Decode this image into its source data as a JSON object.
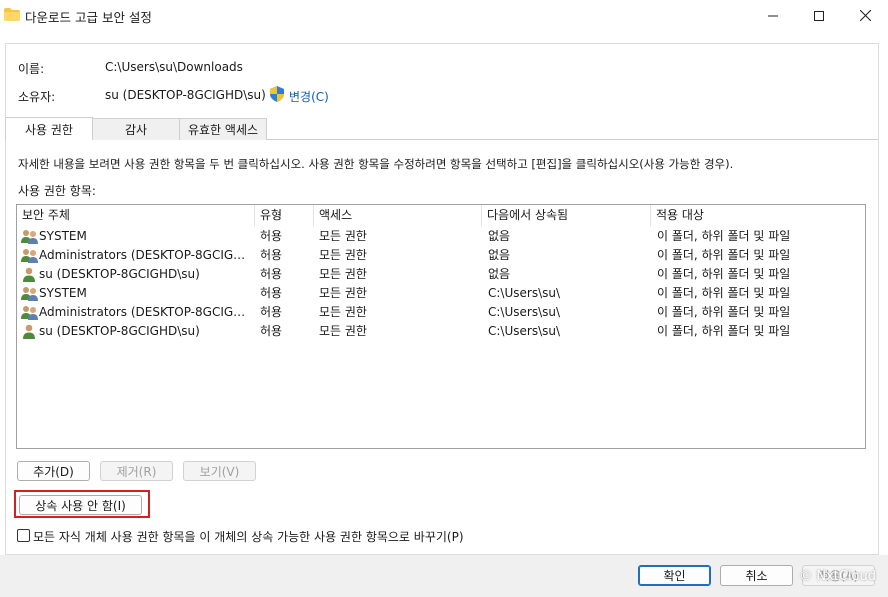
{
  "window": {
    "title": "다운로드 고급 보안 설정",
    "minimize_glyph": "—",
    "maximize_glyph": "☐",
    "close_glyph": "✕"
  },
  "info": {
    "name_label": "이름:",
    "name_value": "C:\\Users\\su\\Downloads",
    "owner_label": "소유자:",
    "owner_value": "su (DESKTOP-8GCIGHD\\su)",
    "change_link": "변경(C)"
  },
  "tabs": [
    {
      "label": "사용 권한",
      "active": true
    },
    {
      "label": "감사",
      "active": false
    },
    {
      "label": "유효한 액세스",
      "active": false
    }
  ],
  "instructions": "자세한 내용을 보려면 사용 권한 항목을 두 번 클릭하십시오. 사용 권한 항목을 수정하려면 항목을 선택하고 [편집]을 클릭하십시오(사용 가능한 경우).",
  "entries_label": "사용 권한 항목:",
  "table": {
    "columns": [
      "보안 주체",
      "유형",
      "액세스",
      "다음에서 상속됨",
      "적용 대상"
    ],
    "rows": [
      {
        "icon": "group-users-icon",
        "principal": "SYSTEM",
        "type": "허용",
        "access": "모든 권한",
        "inherited": "없음",
        "applies": "이 폴더, 하위 폴더 및 파일"
      },
      {
        "icon": "group-users-icon",
        "principal": "Administrators (DESKTOP-8GCIGHD\\...",
        "type": "허용",
        "access": "모든 권한",
        "inherited": "없음",
        "applies": "이 폴더, 하위 폴더 및 파일"
      },
      {
        "icon": "single-user-icon",
        "principal": "su (DESKTOP-8GCIGHD\\su)",
        "type": "허용",
        "access": "모든 권한",
        "inherited": "없음",
        "applies": "이 폴더, 하위 폴더 및 파일"
      },
      {
        "icon": "group-users-icon",
        "principal": "SYSTEM",
        "type": "허용",
        "access": "모든 권한",
        "inherited": "C:\\Users\\su\\",
        "applies": "이 폴더, 하위 폴더 및 파일"
      },
      {
        "icon": "group-users-icon",
        "principal": "Administrators (DESKTOP-8GCIGHD\\...",
        "type": "허용",
        "access": "모든 권한",
        "inherited": "C:\\Users\\su\\",
        "applies": "이 폴더, 하위 폴더 및 파일"
      },
      {
        "icon": "single-user-icon",
        "principal": "su (DESKTOP-8GCIGHD\\su)",
        "type": "허용",
        "access": "모든 권한",
        "inherited": "C:\\Users\\su\\",
        "applies": "이 폴더, 하위 폴더 및 파일"
      }
    ]
  },
  "buttons": {
    "add": "추가(D)",
    "remove": "제거(R)",
    "view": "보기(V)",
    "disable_inheritance": "상속 사용 안 함(I)",
    "ok": "확인",
    "cancel": "취소",
    "apply": "적용(A)"
  },
  "checkbox": {
    "label": "모든 자식 개체 사용 권한 항목을 이 개체의 상속 가능한 사용 권한 항목으로 바꾸기(P)",
    "checked": false
  },
  "watermark": "© NxtCloud",
  "colors": {
    "link": "#0a5fb4",
    "highlight_box": "#d62020",
    "primary_border": "#1f6fbf"
  }
}
